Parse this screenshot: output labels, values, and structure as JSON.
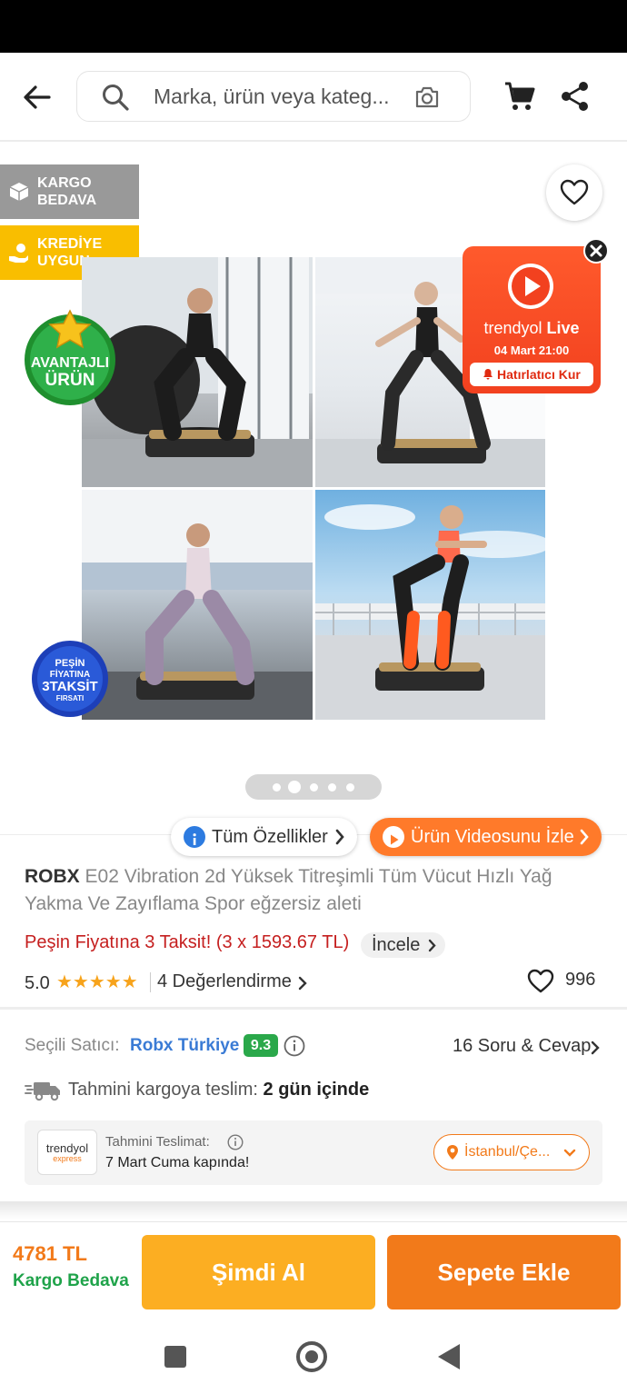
{
  "search": {
    "placeholder": "Marka, ürün veya kateg..."
  },
  "badges": {
    "kargo": "KARGO BEDAVA",
    "kredi": "KREDİYE UYGUN"
  },
  "stickers": {
    "avantajli_1": "AVANTAJLI",
    "avantajli_2": "ÜRÜN",
    "pesin_1": "PEŞİN",
    "pesin_2": "FİYATINA",
    "pesin_3": "3TAKSİT",
    "pesin_4": "FIRSATI"
  },
  "live": {
    "brand_light": "trendyol",
    "brand_bold": "Live",
    "date": "04 Mart 21:00",
    "remind": "Hatırlatıcı Kur",
    "close": "×"
  },
  "gallery": {
    "active_index": 1,
    "count": 5
  },
  "actions": {
    "features": "Tüm Özellikler",
    "video": "Ürün Videosunu İzle"
  },
  "product": {
    "brand": "ROBX",
    "name": "E02 Vibration 2d Yüksek Titreşimli Tüm Vücut Hızlı Yağ Yakma Ve Zayıflama Spor eğzersiz aleti",
    "installment": "Peşin Fiyatına 3 Taksit! (3 x 1593.67 TL)",
    "inspect": "İncele",
    "rating": "5.0",
    "stars": "★★★★★",
    "reviews": "4 Değerlendirme",
    "favorites": "996"
  },
  "seller": {
    "label": "Seçili Satıcı:",
    "name": "Robx Türkiye",
    "score": "9.3",
    "qa": "16 Soru & Cevap"
  },
  "delivery": {
    "label": "Tahmini kargoya teslim:",
    "value": "2 gün içinde",
    "logo_a": "trendyol",
    "logo_b": "express",
    "est_label": "Tahmini Teslimat:",
    "est_date": "7 Mart Cuma kapında!",
    "location": "İstanbul/Çe..."
  },
  "bottom": {
    "price": "4781 TL",
    "shipping": "Kargo Bedava",
    "buy_now": "Şimdi Al",
    "add_to_cart": "Sepete Ekle"
  },
  "colors": {
    "brand_orange": "#f27a1a",
    "buy_yellow": "#fcae22",
    "green": "#1fa34a",
    "red": "#c51f1f",
    "link_blue": "#3a7bd5"
  }
}
